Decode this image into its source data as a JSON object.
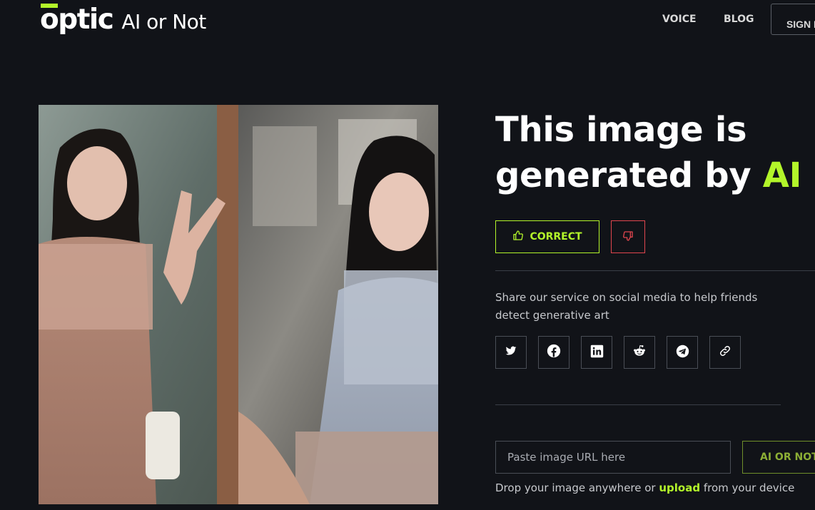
{
  "header": {
    "logo_mark": "optic",
    "logo_sub": "AI or Not",
    "nav": {
      "voice": "VOICE",
      "blog": "BLOG",
      "signin": "SIGN IN"
    }
  },
  "image_panel": {
    "content": "uploaded-photo-collage"
  },
  "result": {
    "headline_prefix": "This image is generated by ",
    "headline_highlight": "AI",
    "correct_label": "CORRECT",
    "incorrect_icon": "thumbs-down-icon"
  },
  "share": {
    "text": "Share our service on social media to help friends detect generative art",
    "icons": [
      "twitter-icon",
      "facebook-icon",
      "linkedin-icon",
      "reddit-icon",
      "telegram-icon",
      "link-icon"
    ]
  },
  "check": {
    "url_placeholder": "Paste image URL here",
    "button_label": "AI OR NOT?",
    "drop_prefix": "Drop your image anywhere or ",
    "upload_label": "upload",
    "drop_suffix": " from your device"
  },
  "colors": {
    "background": "#111318",
    "accent": "#b3f52a",
    "danger": "#e0464e",
    "text": "#ffffff",
    "muted": "#c7c9cd"
  }
}
